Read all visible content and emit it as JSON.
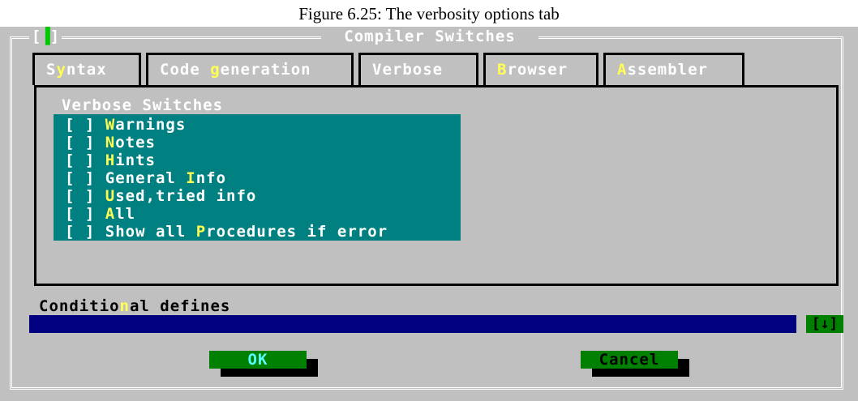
{
  "caption": "Figure 6.25: The verbosity options tab",
  "window": {
    "title": "Compiler Switches",
    "close_open": "[",
    "close_mark": "▐",
    "close_end": "]"
  },
  "tabs": [
    {
      "pre": "S",
      "hot": "y",
      "post": "ntax",
      "active": false
    },
    {
      "pre": "Code ",
      "hot": "g",
      "post": "eneration",
      "active": false
    },
    {
      "pre": "",
      "hot": "",
      "post": "Verbose",
      "active": true
    },
    {
      "pre": "",
      "hot": "B",
      "post": "rowser",
      "active": false
    },
    {
      "pre": "",
      "hot": "A",
      "post": "ssembler",
      "active": false
    }
  ],
  "group_label": "Verbose Switches",
  "checkboxes": [
    {
      "box": "[ ] ",
      "pre": "",
      "hot": "W",
      "post": "arnings"
    },
    {
      "box": "[ ] ",
      "pre": "",
      "hot": "N",
      "post": "otes"
    },
    {
      "box": "[ ] ",
      "pre": "",
      "hot": "H",
      "post": "ints"
    },
    {
      "box": "[ ] ",
      "pre": "General ",
      "hot": "I",
      "post": "nfo"
    },
    {
      "box": "[ ] ",
      "pre": "",
      "hot": "U",
      "post": "sed,tried info"
    },
    {
      "box": "[ ] ",
      "pre": "",
      "hot": "A",
      "post": "ll"
    },
    {
      "box": "[ ] ",
      "pre": "Show all ",
      "hot": "P",
      "post": "rocedures if error"
    }
  ],
  "conditional": {
    "label_pre": "Conditio",
    "label_hot": "n",
    "label_post": "al defines",
    "value": "",
    "history_button": "[↓]"
  },
  "buttons": {
    "ok": "OK",
    "cancel": "Cancel"
  }
}
